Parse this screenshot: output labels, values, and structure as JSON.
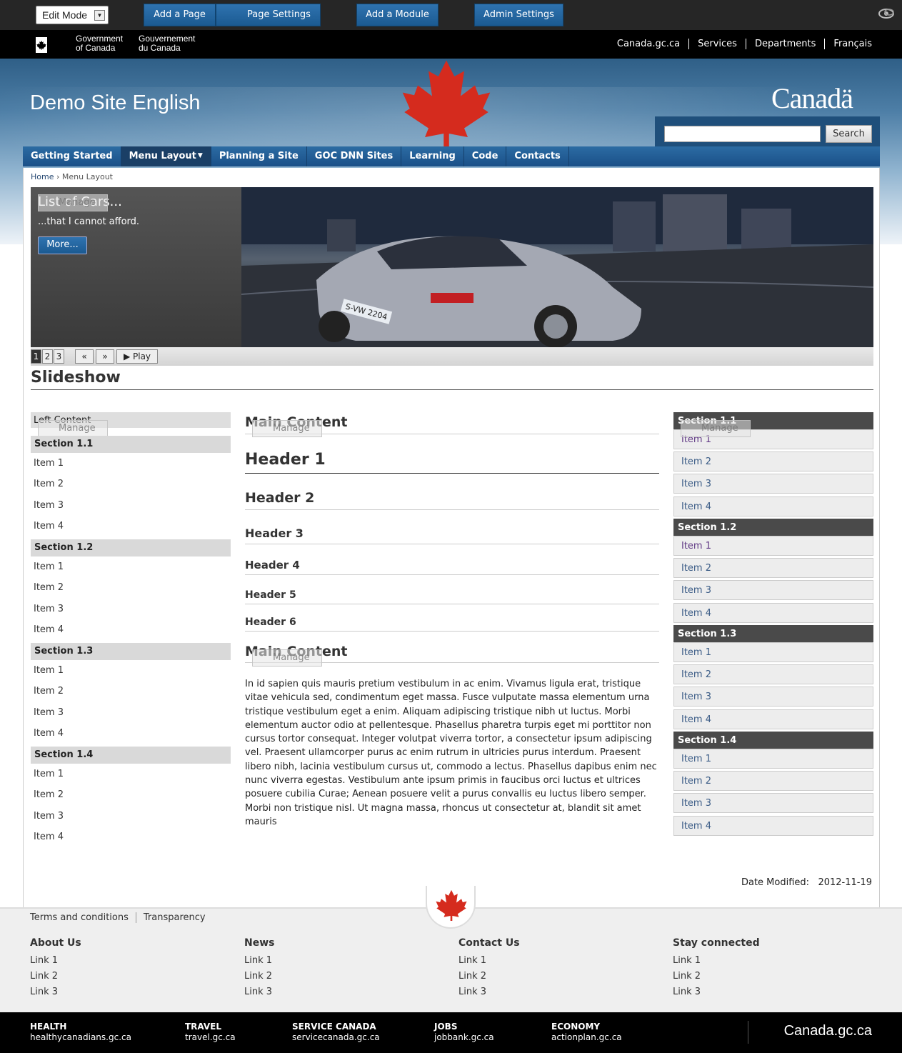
{
  "controlbar": {
    "edit_mode": "Edit Mode",
    "add_page": "Add a Page",
    "page_settings": "Page Settings",
    "add_module": "Add a Module",
    "admin_settings": "Admin Settings"
  },
  "fip": {
    "gov_en_1": "Government",
    "gov_en_2": "of Canada",
    "gov_fr_1": "Gouvernement",
    "gov_fr_2": "du Canada",
    "links": [
      "Canada.gc.ca",
      "Services",
      "Departments",
      "Français"
    ]
  },
  "header": {
    "site_title": "Demo Site English",
    "wordmark": "Canadä",
    "search_placeholder": "",
    "search_button": "Search"
  },
  "nav": {
    "items": [
      "Getting Started",
      "Menu Layout",
      "Planning a Site",
      "GOC DNN Sites",
      "Learning",
      "Code",
      "Contacts"
    ],
    "active_index": 1
  },
  "breadcrumb": {
    "home": "Home",
    "separator": "›",
    "current": "Menu Layout"
  },
  "slideshow": {
    "title": "List of Cars...",
    "subtitle": "...that I cannot afford.",
    "more_button": "More...",
    "pages": [
      "1",
      "2",
      "3"
    ],
    "prev": "«",
    "next": "»",
    "play": "Play",
    "heading": "Slideshow",
    "plate": "S-VW 2204"
  },
  "manage_label": "Manage",
  "left": {
    "title": "Left Content",
    "sections": [
      {
        "title": "Section 1.1",
        "items": [
          "Item 1",
          "Item 2",
          "Item 3",
          "Item 4"
        ]
      },
      {
        "title": "Section 1.2",
        "items": [
          "Item 1",
          "Item 2",
          "Item 3",
          "Item 4"
        ]
      },
      {
        "title": "Section 1.3",
        "items": [
          "Item 1",
          "Item 2",
          "Item 3",
          "Item 4"
        ]
      },
      {
        "title": "Section 1.4",
        "items": [
          "Item 1",
          "Item 2",
          "Item 3",
          "Item 4"
        ]
      }
    ]
  },
  "center": {
    "title": "Main Content",
    "h1": "Header 1",
    "h2": "Header 2",
    "h3": "Header 3",
    "h4": "Header 4",
    "h5": "Header 5",
    "h6": "Header 6",
    "title2": "Main Content",
    "paragraph": "In id sapien quis mauris pretium vestibulum in ac enim. Vivamus ligula erat, tristique vitae vehicula sed, condimentum eget massa. Fusce vulputate massa elementum urna tristique vestibulum eget a enim. Aliquam adipiscing tristique nibh ut luctus. Morbi elementum auctor odio at pellentesque. Phasellus pharetra turpis eget mi porttitor non cursus tortor consequat. Integer volutpat viverra tortor, a consectetur ipsum adipiscing vel. Praesent ullamcorper purus ac enim rutrum in ultricies purus interdum. Praesent libero nibh, lacinia vestibulum cursus ut, commodo a lectus. Phasellus dapibus enim nec nunc viverra egestas. Vestibulum ante ipsum primis in faucibus orci luctus et ultrices posuere cubilia Curae; Aenean posuere velit a purus convallis eu luctus libero semper. Morbi non tristique nisl. Ut magna massa, rhoncus ut consectetur at, blandit sit amet mauris"
  },
  "right": {
    "sections": [
      {
        "title": "Section 1.1",
        "items": [
          "Item 1",
          "Item 2",
          "Item 3",
          "Item 4"
        ]
      },
      {
        "title": "Section 1.2",
        "items": [
          "Item 1",
          "Item 2",
          "Item 3",
          "Item 4"
        ]
      },
      {
        "title": "Section 1.3",
        "items": [
          "Item 1",
          "Item 2",
          "Item 3",
          "Item 4"
        ]
      },
      {
        "title": "Section 1.4",
        "items": [
          "Item 1",
          "Item 2",
          "Item 3",
          "Item 4"
        ]
      }
    ]
  },
  "date_modified": {
    "label": "Date Modified:",
    "value": "2012-11-19"
  },
  "footer": {
    "links": [
      "Terms and conditions",
      "Transparency"
    ],
    "columns": [
      {
        "title": "About Us",
        "links": [
          "Link 1",
          "Link 2",
          "Link 3"
        ]
      },
      {
        "title": "News",
        "links": [
          "Link 1",
          "Link 2",
          "Link 3"
        ]
      },
      {
        "title": "Contact Us",
        "links": [
          "Link 1",
          "Link 2",
          "Link 3"
        ]
      },
      {
        "title": "Stay connected",
        "links": [
          "Link 1",
          "Link 2",
          "Link 3"
        ]
      }
    ],
    "bottom": [
      {
        "title": "HEALTH",
        "url": "healthycanadians.gc.ca"
      },
      {
        "title": "TRAVEL",
        "url": "travel.gc.ca"
      },
      {
        "title": "SERVICE CANADA",
        "url": "servicecanada.gc.ca"
      },
      {
        "title": "JOBS",
        "url": "jobbank.gc.ca"
      },
      {
        "title": "ECONOMY",
        "url": "actionplan.gc.ca"
      }
    ],
    "canada": "Canada.gc.ca"
  },
  "colors": {
    "accent": "#1b5a92",
    "nav": "#2c6ca3",
    "maple": "#d52b1e"
  },
  "icons": {
    "eye": "eye-icon",
    "maple": "maple-leaf-icon"
  }
}
